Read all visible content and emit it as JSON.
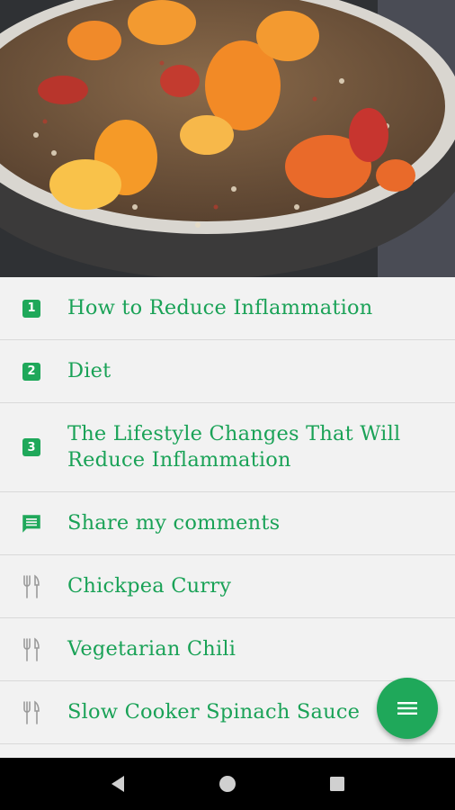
{
  "hero": {
    "icon": "food-photo-quinoa-bowl"
  },
  "menu": {
    "items": [
      {
        "badge": "1",
        "label": "How to Reduce Inflammation",
        "icon": "number-badge-icon"
      },
      {
        "badge": "2",
        "label": "Diet",
        "icon": "number-badge-icon"
      },
      {
        "badge": "3",
        "label": "The Lifestyle Changes That Will Reduce Inflammation",
        "icon": "number-badge-icon"
      },
      {
        "label": "Share my comments",
        "icon": "comment-icon"
      },
      {
        "label": "Chickpea Curry",
        "icon": "fork-knife-icon"
      },
      {
        "label": "Vegetarian Chili",
        "icon": "fork-knife-icon"
      },
      {
        "label": "Slow Cooker Spinach Sauce",
        "icon": "fork-knife-icon"
      }
    ]
  },
  "fab": {
    "icon": "menu-icon"
  },
  "navbar": {
    "back": "back-icon",
    "home": "home-icon",
    "recents": "recents-icon"
  },
  "colors": {
    "accent": "#1fa85a",
    "text": "#1aa257",
    "background": "#f2f2f2"
  }
}
